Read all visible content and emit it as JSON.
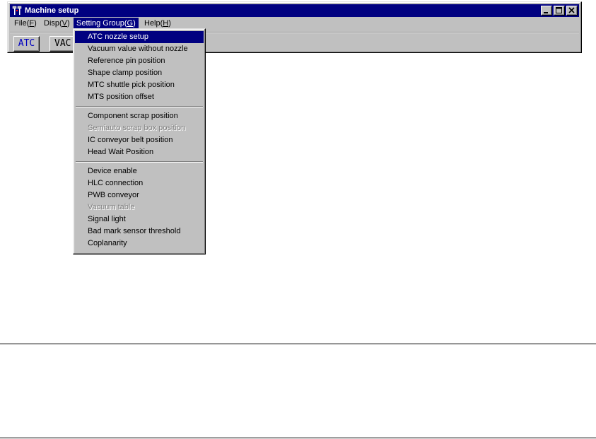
{
  "window": {
    "title": "Machine setup"
  },
  "menubar": {
    "file": {
      "prefix": "File(",
      "key": "F",
      "suffix": ")"
    },
    "disp": {
      "prefix": "Disp(",
      "key": "V",
      "suffix": ")"
    },
    "setting": {
      "prefix": "Setting Group(",
      "key": "G",
      "suffix": ")"
    },
    "help": {
      "prefix": "Help(",
      "key": "H",
      "suffix": ")"
    }
  },
  "toolbar": {
    "atc_label": "ATC",
    "vac_label": "VAC"
  },
  "dropdown": {
    "group1": [
      {
        "label": "ATC nozzle setup"
      },
      {
        "label": "Vacuum value without nozzle"
      },
      {
        "label": "Reference pin position"
      },
      {
        "label": "Shape clamp position"
      },
      {
        "label": "MTC shuttle pick position"
      },
      {
        "label": "MTS position offset"
      }
    ],
    "group2": [
      {
        "label": "Component scrap position"
      },
      {
        "label": "Semiauto scrap box position"
      },
      {
        "label": "IC conveyor belt position"
      },
      {
        "label": "Head Wait Position"
      }
    ],
    "group3": [
      {
        "label": "Device enable"
      },
      {
        "label": "HLC connection"
      },
      {
        "label": "PWB conveyor"
      },
      {
        "label": "Vacuum table"
      },
      {
        "label": "Signal light"
      },
      {
        "label": "Bad mark sensor threshold"
      },
      {
        "label": "Coplanarity"
      }
    ]
  },
  "colors": {
    "titlebar": "#000080",
    "face": "#c0c0c0",
    "highlight": "#000080",
    "atc_text": "#0000c0"
  }
}
